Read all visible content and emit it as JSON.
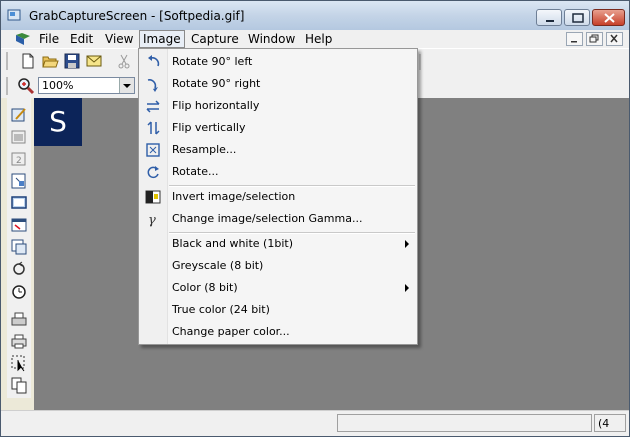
{
  "window": {
    "title": "GrabCaptureScreen - [Softpedia.gif]"
  },
  "menubar": {
    "items": [
      "File",
      "Edit",
      "View",
      "Image",
      "Capture",
      "Window",
      "Help"
    ],
    "active": "Image"
  },
  "toolbar": {
    "zoom_value": "100%"
  },
  "canvas": {
    "logo_text": "S",
    "logo_color": "#0c2459",
    "background": "#808080"
  },
  "image_menu": {
    "items": [
      {
        "label": "Rotate 90° left",
        "icon": "rotate-left-icon",
        "submenu": false
      },
      {
        "label": "Rotate 90° right",
        "icon": "rotate-right-icon",
        "submenu": false
      },
      {
        "label": "Flip horizontally",
        "icon": "flip-horizontal-icon",
        "submenu": false
      },
      {
        "label": "Flip vertically",
        "icon": "flip-vertical-icon",
        "submenu": false
      },
      {
        "label": "Resample...",
        "icon": "resample-icon",
        "submenu": false
      },
      {
        "label": "Rotate...",
        "icon": "rotate-icon",
        "submenu": false
      },
      {
        "label": "Invert image/selection",
        "icon": "invert-icon",
        "submenu": false
      },
      {
        "label": "Change image/selection Gamma...",
        "icon": "gamma-icon",
        "submenu": false
      },
      {
        "label": "Black and white (1bit)",
        "icon": "",
        "submenu": true
      },
      {
        "label": "Greyscale (8 bit)",
        "icon": "",
        "submenu": false
      },
      {
        "label": "Color (8 bit)",
        "icon": "",
        "submenu": true
      },
      {
        "label": "True color (24 bit)",
        "icon": "",
        "submenu": false
      },
      {
        "label": "Change paper color...",
        "icon": "",
        "submenu": false
      }
    ]
  },
  "statusbar": {
    "right_text": "(4"
  }
}
